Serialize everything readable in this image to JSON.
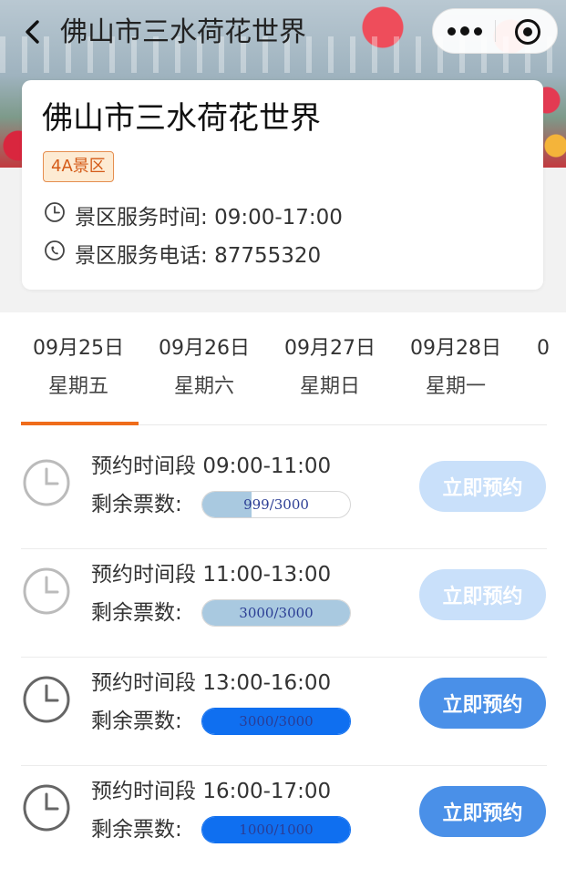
{
  "header": {
    "title": "佛山市三水荷花世界"
  },
  "scenic": {
    "name": "佛山市三水荷花世界",
    "level_tag": "4A景区",
    "hours_label": "景区服务时间:",
    "hours_value": "09:00-17:00",
    "phone_label": "景区服务电话:",
    "phone_value": "87755320"
  },
  "dates": [
    {
      "date": "09月25日",
      "weekday": "星期五",
      "active": true
    },
    {
      "date": "09月26日",
      "weekday": "星期六",
      "active": false
    },
    {
      "date": "09月27日",
      "weekday": "星期日",
      "active": false
    },
    {
      "date": "09月28日",
      "weekday": "星期一",
      "active": false
    },
    {
      "date": "0",
      "weekday": "",
      "active": false
    }
  ],
  "slot_label": "预约时间段",
  "remaining_label": "剩余票数:",
  "slots": [
    {
      "time": "09:00-11:00",
      "remaining": 999,
      "total": 3000,
      "ratio_text": "999/3000",
      "available": false,
      "button": "立即预约"
    },
    {
      "time": "11:00-13:00",
      "remaining": 3000,
      "total": 3000,
      "ratio_text": "3000/3000",
      "available": false,
      "button": "立即预约"
    },
    {
      "time": "13:00-16:00",
      "remaining": 3000,
      "total": 3000,
      "ratio_text": "3000/3000",
      "available": true,
      "button": "立即预约"
    },
    {
      "time": "16:00-17:00",
      "remaining": 1000,
      "total": 1000,
      "ratio_text": "1000/1000",
      "available": true,
      "button": "立即预约"
    }
  ],
  "colors": {
    "accent_orange": "#ef6c1b",
    "button_active": "#4a90e8",
    "button_disabled": "#c9e0fa",
    "bar_active": "#0f6ff0",
    "bar_disabled": "#a9c9e0",
    "clock_active": "#666666",
    "clock_disabled": "#bbbbbb"
  },
  "icons": {
    "back": "chevron-left-icon",
    "more": "more-dots-icon",
    "close": "target-circle-icon",
    "hours": "clock-icon",
    "phone": "phone-icon",
    "slot": "clock-icon"
  }
}
